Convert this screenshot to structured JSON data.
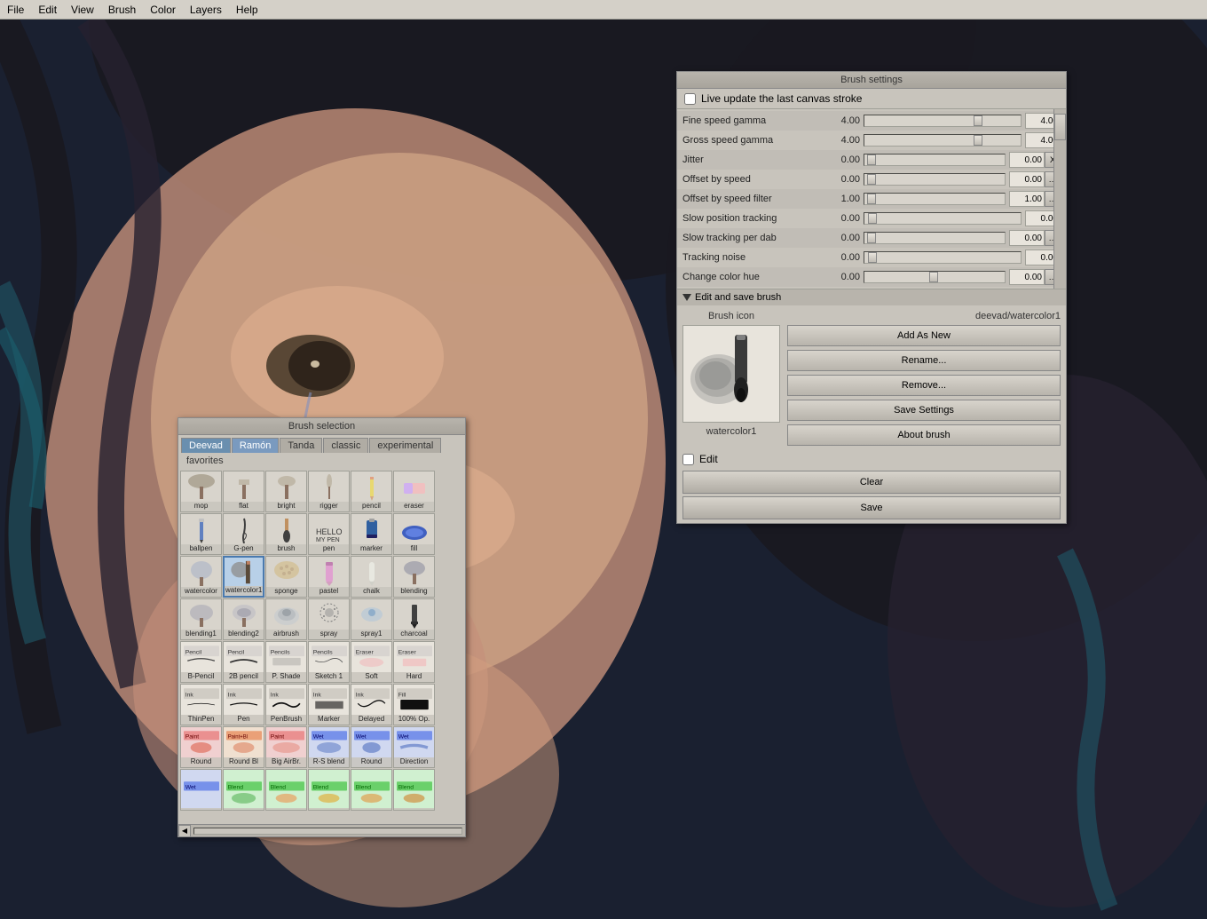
{
  "menubar": {
    "items": [
      "File",
      "Edit",
      "View",
      "Brush",
      "Color",
      "Layers",
      "Help"
    ]
  },
  "brush_selection": {
    "title": "Brush selection",
    "tabs": [
      "Deevad",
      "Ramón",
      "Tanda",
      "classic",
      "experimental"
    ],
    "active_tab": "Deevad",
    "active_tab2": "Ramón",
    "subtabs": [
      "favorites"
    ],
    "brushes": [
      [
        {
          "label": "mop",
          "type": "icon"
        },
        {
          "label": "flat",
          "type": "icon"
        },
        {
          "label": "bright",
          "type": "icon"
        },
        {
          "label": "rigger",
          "type": "icon"
        },
        {
          "label": "pencil",
          "type": "icon"
        },
        {
          "label": "eraser",
          "type": "icon"
        }
      ],
      [
        {
          "label": "ballpen",
          "type": "icon"
        },
        {
          "label": "G-pen",
          "type": "icon"
        },
        {
          "label": "brush",
          "type": "icon"
        },
        {
          "label": "pen",
          "type": "icon"
        },
        {
          "label": "marker",
          "type": "icon"
        },
        {
          "label": "fill",
          "type": "icon"
        }
      ],
      [
        {
          "label": "watercolor",
          "type": "icon"
        },
        {
          "label": "watercolor1",
          "type": "icon",
          "selected": true
        },
        {
          "label": "sponge",
          "type": "icon"
        },
        {
          "label": "pastel",
          "type": "icon"
        },
        {
          "label": "chalk",
          "type": "icon"
        },
        {
          "label": "blending",
          "type": "icon"
        }
      ],
      [
        {
          "label": "blending1",
          "type": "icon"
        },
        {
          "label": "blending2",
          "type": "icon"
        },
        {
          "label": "airbrush",
          "type": "icon"
        },
        {
          "label": "spray",
          "type": "icon"
        },
        {
          "label": "spray1",
          "type": "icon"
        },
        {
          "label": "charcoal",
          "type": "icon"
        }
      ],
      [
        {
          "label": "B-Pencil",
          "type": "tagged",
          "tag": "Pencil"
        },
        {
          "label": "2B pencil",
          "type": "tagged",
          "tag": "Pencil"
        },
        {
          "label": "P. Shade",
          "type": "tagged",
          "tag": "Pencils"
        },
        {
          "label": "Sketch 1",
          "type": "tagged",
          "tag": "Pencils"
        },
        {
          "label": "Soft",
          "type": "tagged",
          "tag": "Eraser"
        },
        {
          "label": "Hard",
          "type": "tagged",
          "tag": "Eraser"
        }
      ],
      [
        {
          "label": "ThinPen",
          "type": "tagged",
          "tag": "Ink"
        },
        {
          "label": "Pen",
          "type": "tagged",
          "tag": "Ink"
        },
        {
          "label": "PenBrush",
          "type": "tagged",
          "tag": "Ink"
        },
        {
          "label": "Marker",
          "type": "tagged",
          "tag": "Ink"
        },
        {
          "label": "Delayed",
          "type": "tagged",
          "tag": "Ink"
        },
        {
          "label": "100% Op.",
          "type": "tagged",
          "tag": "Fill"
        }
      ],
      [
        {
          "label": "Round",
          "type": "tagged",
          "tag": "Paint",
          "color": "#e85050"
        },
        {
          "label": "Round Bl",
          "type": "tagged",
          "tag": "Paint+Bl",
          "color": "#e88050"
        },
        {
          "label": "Big AirBr.",
          "type": "tagged",
          "tag": "Paint",
          "color": "#e85050"
        },
        {
          "label": "R-S blend",
          "type": "tagged",
          "tag": "Wet",
          "color": "#5080e8"
        },
        {
          "label": "Round",
          "type": "tagged",
          "tag": "Wet",
          "color": "#5080e8"
        },
        {
          "label": "Direction",
          "type": "tagged",
          "tag": "Wet",
          "color": "#5080e8"
        }
      ],
      [
        {
          "label": "",
          "type": "tagged",
          "tag": "Wet",
          "color": "#5080e8"
        },
        {
          "label": "",
          "type": "tagged",
          "tag": "Blend",
          "color": "#50c850"
        },
        {
          "label": "",
          "type": "tagged",
          "tag": "Blend",
          "color": "#50c850"
        },
        {
          "label": "",
          "type": "tagged",
          "tag": "Blend",
          "color": "#50c850"
        },
        {
          "label": "",
          "type": "tagged",
          "tag": "Blend",
          "color": "#50c850"
        },
        {
          "label": "",
          "type": "tagged",
          "tag": "Blend",
          "color": "#50c850"
        }
      ]
    ]
  },
  "brush_settings": {
    "title": "Brush settings",
    "live_update_label": "Live update the last canvas stroke",
    "params": [
      {
        "label": "Fine speed gamma",
        "value": "4.00",
        "input": "4.00",
        "thumb_pos": "70%"
      },
      {
        "label": "Gross speed gamma",
        "value": "4.00",
        "input": "4.00",
        "thumb_pos": "70%"
      },
      {
        "label": "Jitter",
        "value": "0.00",
        "input": "0.00",
        "thumb_pos": "5%",
        "has_x": true
      },
      {
        "label": "Offset by speed",
        "value": "0.00",
        "input": "0.00",
        "thumb_pos": "5%",
        "has_dots": true
      },
      {
        "label": "Offset by speed filter",
        "value": "1.00",
        "input": "1.00",
        "thumb_pos": "5%",
        "has_dots": true
      },
      {
        "label": "Slow position tracking",
        "value": "0.00",
        "input": "0.00",
        "thumb_pos": "5%"
      },
      {
        "label": "Slow tracking per dab",
        "value": "0.00",
        "input": "0.00",
        "thumb_pos": "5%",
        "has_dots": true
      },
      {
        "label": "Tracking noise",
        "value": "0.00",
        "input": "0.00",
        "thumb_pos": "5%"
      },
      {
        "label": "Change color hue",
        "value": "0.00",
        "input": "0.00",
        "thumb_pos": "50%",
        "has_dots": true
      }
    ],
    "edit_save": {
      "header": "Edit and save brush",
      "brush_icon_label": "Brush icon",
      "brush_name": "watercolor1",
      "brush_path": "deevad/watercolor1",
      "edit_checkbox_label": "Edit",
      "buttons": [
        "Add As New",
        "Rename...",
        "Remove...",
        "Save Settings",
        "About brush"
      ],
      "clear_label": "Clear",
      "save_label": "Save"
    }
  }
}
